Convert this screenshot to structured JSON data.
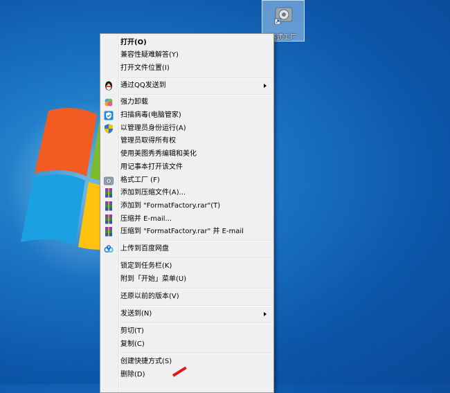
{
  "desktop_icon": {
    "label": "格式工厂"
  },
  "menu": {
    "items": [
      {
        "label": "打开(O)"
      },
      {
        "label": "兼容性疑难解答(Y)"
      },
      {
        "label": "打开文件位置(I)"
      },
      {
        "label": "通过QQ发送到"
      },
      {
        "label": "强力卸载"
      },
      {
        "label": "扫描病毒(电脑管家)"
      },
      {
        "label": "以管理员身份运行(A)"
      },
      {
        "label": "管理员取得所有权"
      },
      {
        "label": "使用美图秀秀编辑和美化"
      },
      {
        "label": "用记事本打开该文件"
      },
      {
        "label": "格式工厂 (F)"
      },
      {
        "label": "添加到压缩文件(A)..."
      },
      {
        "label": "添加到 \"FormatFactory.rar\"(T)"
      },
      {
        "label": "压缩并 E-mail..."
      },
      {
        "label": "压缩到 \"FormatFactory.rar\" 并 E-mail"
      },
      {
        "label": "上传到百度网盘"
      },
      {
        "label": "锁定到任务栏(K)"
      },
      {
        "label": "附到「开始」菜单(U)"
      },
      {
        "label": "还原以前的版本(V)"
      },
      {
        "label": "发送到(N)"
      },
      {
        "label": "剪切(T)"
      },
      {
        "label": "复制(C)"
      },
      {
        "label": "创建快捷方式(S)"
      },
      {
        "label": "删除(D)"
      }
    ]
  }
}
